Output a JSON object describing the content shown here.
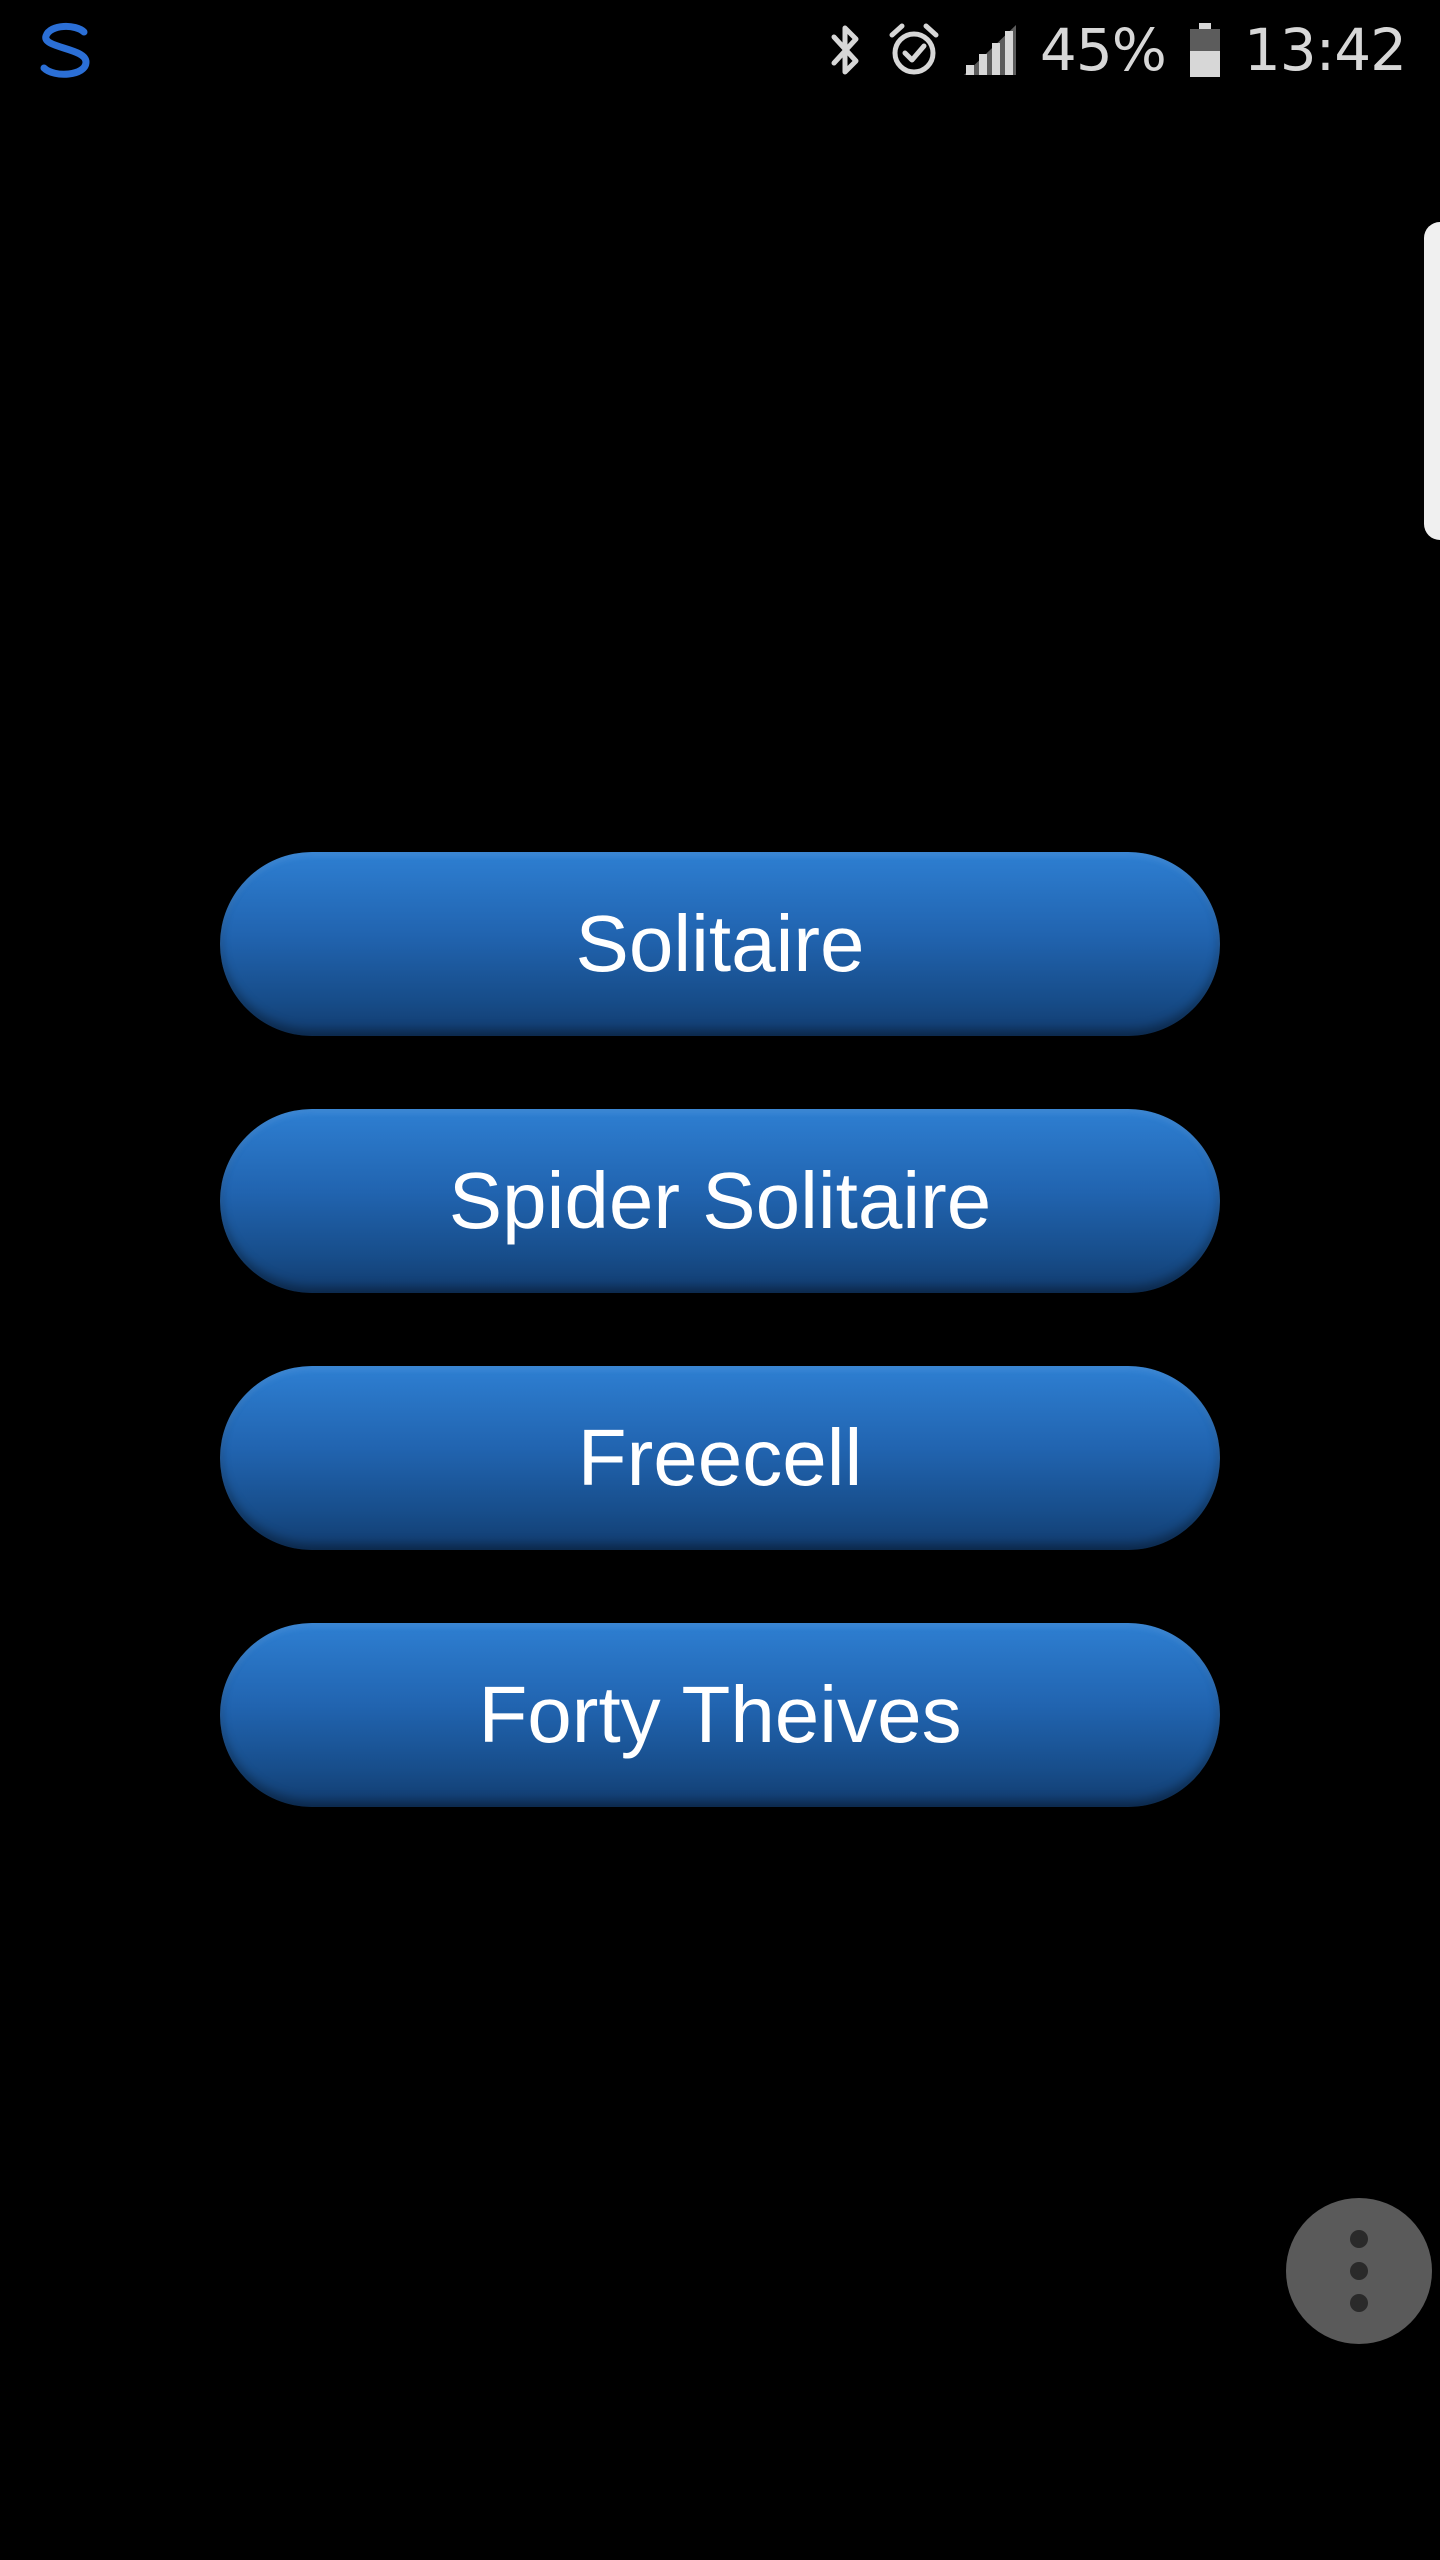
{
  "status_bar": {
    "left_icon": "s-logo-icon",
    "icons": [
      "bluetooth-icon",
      "alarm-icon",
      "signal-icon"
    ],
    "battery_percent": "45%",
    "battery_icon": "battery-icon",
    "time": "13:42"
  },
  "menu": {
    "buttons": [
      {
        "label": "Solitaire"
      },
      {
        "label": "Spider Solitaire"
      },
      {
        "label": "Freecell"
      },
      {
        "label": "Forty Theives"
      }
    ]
  },
  "overflow": {
    "icon": "more-vertical-icon"
  },
  "colors": {
    "background": "#000000",
    "button_top": "#2e7fd2",
    "button_bottom": "#123c6f",
    "button_text": "#ffffff",
    "status_text": "#d7d7d7",
    "logo_blue": "#2b6fd6",
    "overflow_bg": "#5a5a5a"
  }
}
